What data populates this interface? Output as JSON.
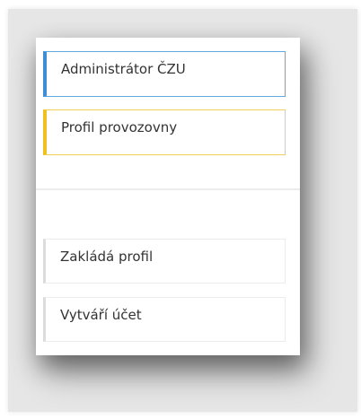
{
  "cards": {
    "admin": {
      "label": "Administrátor ČZU",
      "accent": "#3e8ed6"
    },
    "profile": {
      "label": "Profil provozovny",
      "accent": "#f0c020"
    },
    "zaklada": {
      "label": "Zakládá profil",
      "accent": "#dcdcdc"
    },
    "vytvari": {
      "label": "Vytváří účet",
      "accent": "#dcdcdc"
    }
  }
}
